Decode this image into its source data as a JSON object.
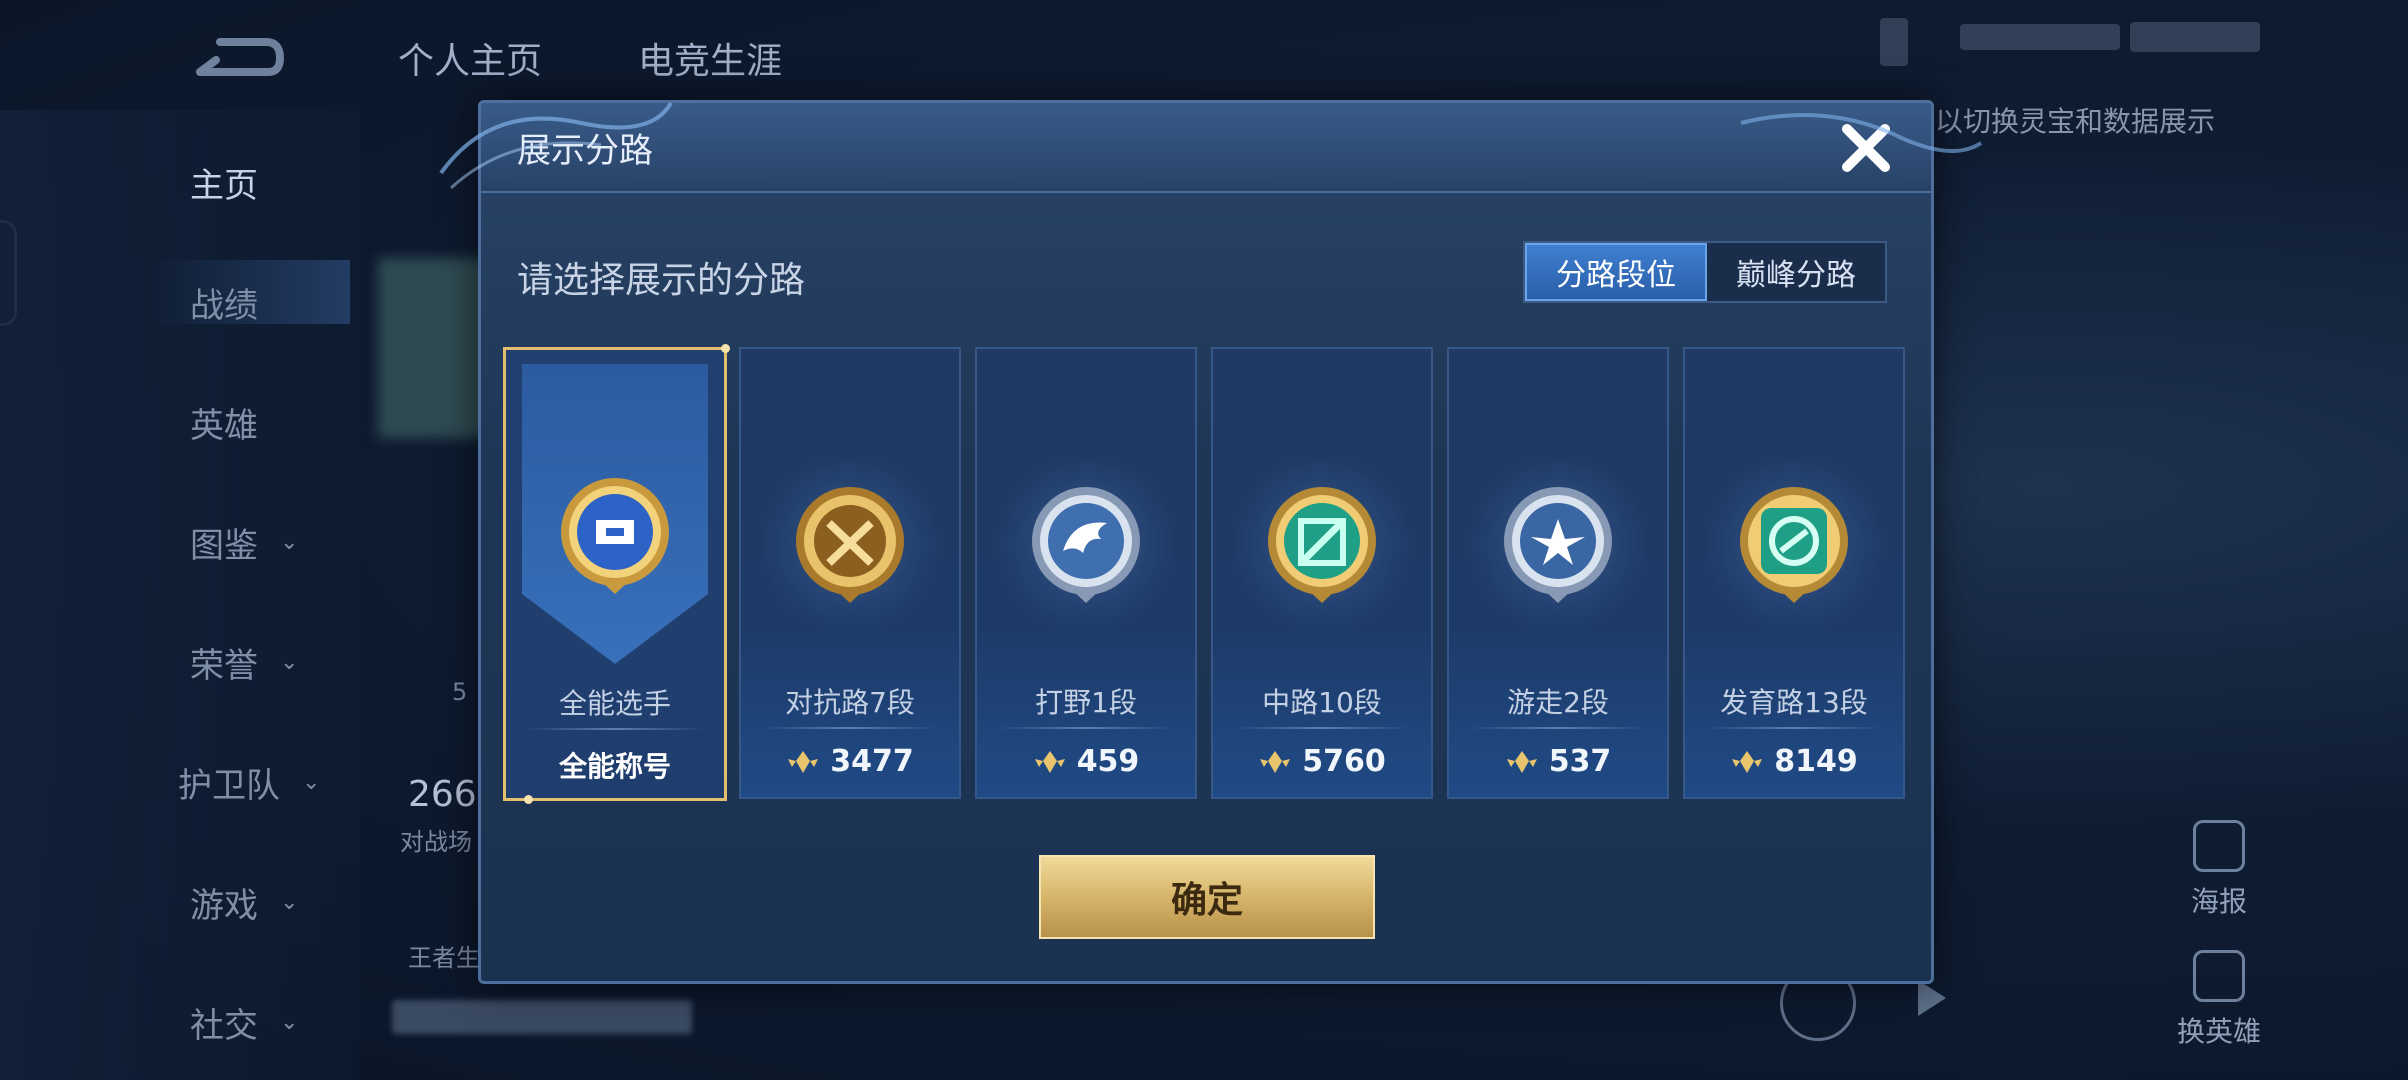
{
  "top_nav": {
    "tabs": [
      "个人主页",
      "电竞生涯"
    ]
  },
  "background": {
    "hint": "以切换灵宝和数据展示",
    "stat_value": "266",
    "stat_label": "对战场",
    "partial_5": "5",
    "bottom_label": "王者生"
  },
  "sidebar": {
    "items": [
      {
        "label": "主页"
      },
      {
        "label": "战绩"
      },
      {
        "label": "英雄"
      },
      {
        "label": "图鉴"
      },
      {
        "label": "荣誉"
      },
      {
        "label": "护卫队"
      },
      {
        "label": "游戏"
      },
      {
        "label": "社交"
      }
    ]
  },
  "right_actions": [
    {
      "label": "海报",
      "icon": "poster-icon"
    },
    {
      "label": "换英雄",
      "icon": "swap-hero-icon"
    }
  ],
  "modal": {
    "title": "展示分路",
    "prompt": "请选择展示的分路",
    "toggle": {
      "left": "分路段位",
      "right": "巅峰分路",
      "active": "left"
    },
    "confirm": "确定",
    "cards": [
      {
        "name": "全能选手",
        "value": "全能称号",
        "selected": true,
        "icon": "all-round-badge-icon"
      },
      {
        "name": "对抗路7段",
        "value": "3477",
        "icon": "clash-lane-badge-icon"
      },
      {
        "name": "打野1段",
        "value": "459",
        "icon": "jungle-badge-icon"
      },
      {
        "name": "中路10段",
        "value": "5760",
        "icon": "mid-lane-badge-icon"
      },
      {
        "name": "游走2段",
        "value": "537",
        "icon": "roam-badge-icon"
      },
      {
        "name": "发育路13段",
        "value": "8149",
        "icon": "farm-lane-badge-icon"
      }
    ]
  },
  "colors": {
    "accent_blue": "#3f7fd0",
    "gold": "#e4bd6e",
    "modal_bg": "#1f3757"
  }
}
